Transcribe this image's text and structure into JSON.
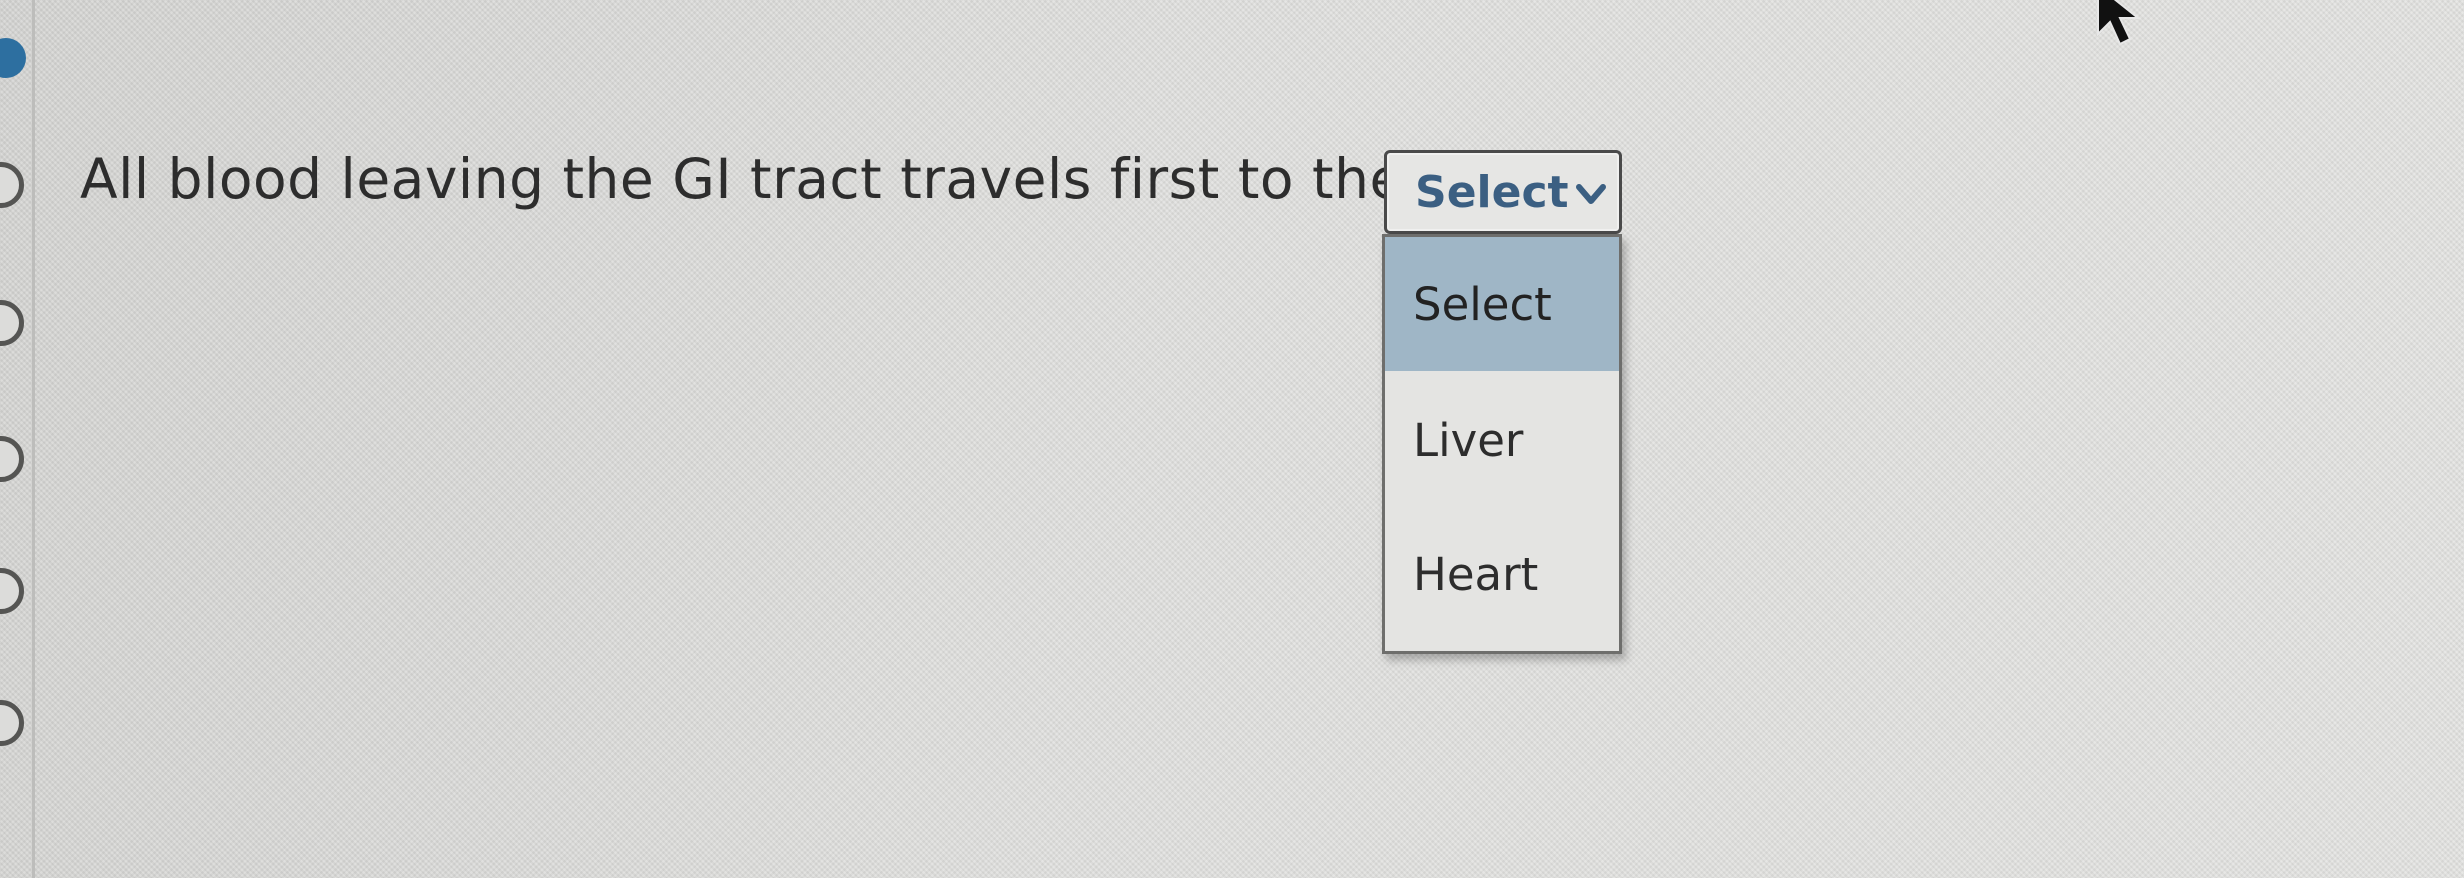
{
  "question": {
    "text": "All blood leaving the GI tract travels first to the"
  },
  "select": {
    "current_value": "Select",
    "chevron_icon": "chevron-down-icon",
    "options": [
      {
        "label": "Select",
        "highlighted": true
      },
      {
        "label": "Liver",
        "highlighted": false
      },
      {
        "label": "Heart",
        "highlighted": false
      }
    ]
  },
  "colors": {
    "select_text": "#3b5f82",
    "highlight": "#9fb6c6",
    "rail_active": "#2d6fa0"
  },
  "icons": {
    "cursor": "mouse-pointer-icon"
  }
}
